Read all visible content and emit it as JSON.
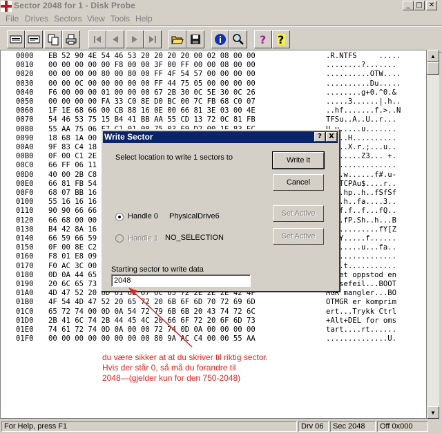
{
  "window": {
    "title": "Sector 2048 for 1 - Disk Probe"
  },
  "menu": [
    "File",
    "Drives",
    "Sectors",
    "View",
    "Tools",
    "Help"
  ],
  "toolbar_icons": [
    "read-sectors-icon",
    "write-sectors-icon",
    "copy-icon",
    "print-icon",
    "first-sector-icon",
    "prev-sector-icon",
    "next-sector-icon",
    "last-sector-icon",
    "open-icon",
    "save-icon",
    "info-icon",
    "search-icon",
    "help-icon",
    "context-help-icon"
  ],
  "hex_rows": [
    {
      "off": "0000",
      "hex": "EB 52 90 4E 54 46 53 20 20 20 20 00 02 08 00 00",
      "asc": ".R.NTFS     ....."
    },
    {
      "off": "0010",
      "hex": "00 00 00 00 00 F8 00 00 3F 00 FF 00 00 08 00 00",
      "asc": "........?......."
    },
    {
      "off": "0020",
      "hex": "00 00 00 00 80 00 80 00 FF 4F 54 57 00 00 00 00",
      "asc": "..........OTW...."
    },
    {
      "off": "0030",
      "hex": "00 00 0C 00 00 00 00 00 FF 44 75 05 00 00 00 00",
      "asc": "..........Du....."
    },
    {
      "off": "0040",
      "hex": "F6 00 00 00 01 00 00 00 67 2B 30 0C 5E 30 0C 26",
      "asc": "........g+0.^0.&"
    },
    {
      "off": "0050",
      "hex": "00 00 00 00 FA 33 C0 8E D0 BC 00 7C FB 68 C0 07",
      "asc": ".....3......|.h.."
    },
    {
      "off": "0060",
      "hex": "1F 1E 68 66 00 CB 88 16 0E 00 66 81 3E 03 00 4E",
      "asc": "..hf.......f.>..N"
    },
    {
      "off": "0070",
      "hex": "54 46 53 75 15 B4 41 BB AA 55 CD 13 72 0C 81 FB",
      "asc": "TFSu..A..U..r..."
    },
    {
      "off": "0080",
      "hex": "55 AA 75 06 F7 C1 01 00 75 03 E9 D2 00 1E 83 EC",
      "asc": "U.u.....u......."
    },
    {
      "off": "0090",
      "hex": "18 68 1A 00 B4 48 8A 16 0E 00 8B F4 16 1F CD 13",
      "asc": ".h...H.........."
    },
    {
      "off": "00A0",
      "hex": "9F 83 C4 18 9E 58 1F 72 E1 3B 06 0B 00 75 DB A3",
      "asc": ".....X.r.;...u.."
    },
    {
      "off": "00B0",
      "hex": "0F 00 C1 2E 0F 00 04 1E 5A 33 DB B9 00 20 2B C8",
      "asc": "........Z3... +."
    },
    {
      "off": "00C0",
      "hex": "66 FF 06 11 00 03 16 0F 00 8E C2 FF 06 16 00 E8",
      "asc": "f..............."
    },
    {
      "off": "00D0",
      "hex": "40 00 2B C8 77 EF B8 00 BB CD 1A 66 23 C0 75 2D",
      "asc": "@.+.w......f#.u-"
    },
    {
      "off": "00E0",
      "hex": "66 81 FB 54 43 50 41 75 24 81 F9 02 01 72 1E 16",
      "asc": "f..TCPAu$....r.."
    },
    {
      "off": "00F0",
      "hex": "68 07 BB 16 68 70 0E 16 68 09 00 66 53 66 53 66",
      "asc": "h...hp..h..fSfSf"
    },
    {
      "off": "0100",
      "hex": "55 16 16 16 68 B8 01 66 61 0E 07 CD 1A 33 C0 BF",
      "asc": "U...h..fa....3.."
    },
    {
      "off": "0110",
      "hex": "90 90 66 66 1F 66 0F 00 66 B9 00 00 66 51 2E 00",
      "asc": "..ff.f..f...fQ.."
    },
    {
      "off": "0120",
      "hex": "66 68 00 00 66 50 06 53 68 01 00 68 10 00 B4 42",
      "asc": "fh..fP.Sh..h...B"
    },
    {
      "off": "0130",
      "hex": "B4 42 8A 16 0E 00 16 1F 8B F4 CD 13 66 59 5B 5A",
      "asc": ".B..........fY[Z"
    },
    {
      "off": "0140",
      "hex": "66 59 66 59 1F 0F 82 16 00 66 FF 06 11 00 03 16",
      "asc": "fYfY.....f......"
    },
    {
      "off": "0150",
      "hex": "0F 00 8E C2 FF 0E 16 00 75 BC 07 1F 66 61 C3 A0",
      "asc": "........u...fa.."
    },
    {
      "off": "0160",
      "hex": "F8 01 E8 09 00 A0 FB 01 E8 03 00 F4 EB FD B4 01",
      "asc": "................"
    },
    {
      "off": "0170",
      "hex": "F0 AC 3C 00 74 09 B4 0E BB 07 00 CD 10 EB F2 C3",
      "asc": "..<.t..........."
    },
    {
      "off": "0180",
      "hex": "0D 0A 44 65 74 20 6F 70 70 73 74 6F 64 20 65 6E",
      "asc": "..Det oppstod en"
    },
    {
      "off": "0190",
      "hex": "20 6C 65 73 65 66 65 69 6C 2E 2E 2E 42 4F 4F 54",
      "asc": " lesefeil...BOOT"
    },
    {
      "off": "01A0",
      "hex": "4D 47 52 20 6D 61 6E 67 6C 65 72 2E 2E 2E 42 4F",
      "asc": "MGR mangler...BO"
    },
    {
      "off": "01B0",
      "hex": "4F 54 4D 47 52 20 65 72 20 6B 6F 6D 70 72 69 6D",
      "asc": "OTMGR er komprim"
    },
    {
      "off": "01C0",
      "hex": "65 72 74 00 0D 0A 54 72 79 6B 6B 20 43 74 72 6C",
      "asc": "ert...Trykk Ctrl"
    },
    {
      "off": "01D0",
      "hex": "2B 41 6C 74 2B 44 45 4C 20 66 6F 72 20 6F 6D 73",
      "asc": "+Alt+DEL for oms"
    },
    {
      "off": "01E0",
      "hex": "74 61 72 74 0D 0A 00 00 72 74 0D 0A 00 00 00 00",
      "asc": "tart....rt......"
    },
    {
      "off": "01F0",
      "hex": "00 00 00 00 00 00 00 00 80 9A AC C4 00 00 55 AA",
      "asc": "..............U."
    }
  ],
  "status": {
    "help": "For Help, press F1",
    "drive": "Drv  06",
    "sector": "Sec 2048",
    "offset": "Off 0x000"
  },
  "dialog": {
    "title": "Write Sector",
    "instruction": "Select location to write 1 sectors to",
    "write_it": "Write it",
    "cancel": "Cancel",
    "handle0_label": "Handle 0",
    "handle0_value": "PhysicalDrive6",
    "handle1_label": "Handle 1",
    "handle1_value": "NO_SELECTION",
    "set_active": "Set Active",
    "start_label": "Starting sector to write data",
    "start_value": "2048",
    "help_btn": "?",
    "close_btn": "X"
  },
  "annotation": {
    "line1": "du være sikker at at du skriver til riktig sector.",
    "line2": "Hvis der står 0, så må du forandre til",
    "line3": "2048—(gjelder kun for den 750-2048)"
  },
  "colors": {
    "annotation": "#e8201a",
    "dialog_title_bg": "#0a246a"
  }
}
